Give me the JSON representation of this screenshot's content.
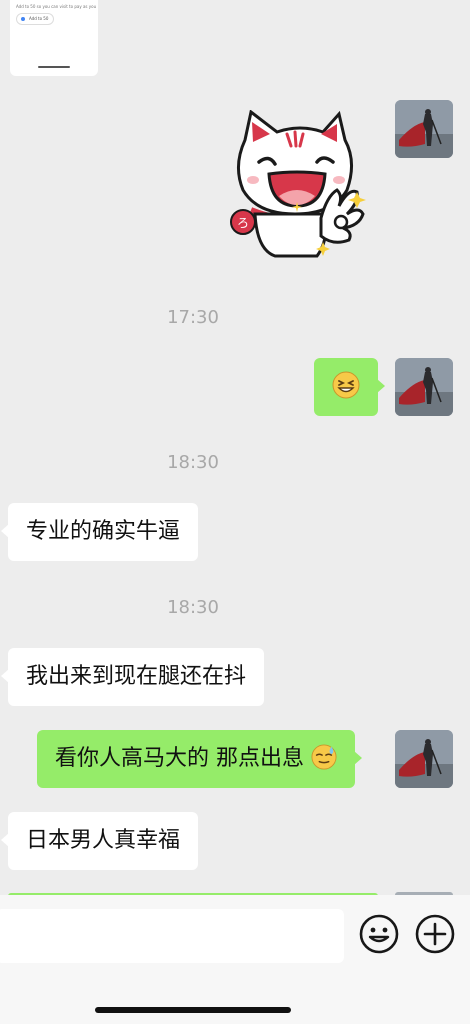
{
  "shared_card": {
    "text": "Add to 50 so you can visit to pay as you bring",
    "chip_label": "Add to 50"
  },
  "messages": [
    {
      "side": "out",
      "type": "sticker",
      "sticker": "cat-ok-sticker"
    },
    {
      "type": "time",
      "text": "17:30"
    },
    {
      "side": "out",
      "type": "emoji",
      "emoji": "grinning-squint-face"
    },
    {
      "type": "time",
      "text": "18:30"
    },
    {
      "side": "in",
      "type": "text",
      "text": "专业的确实牛逼"
    },
    {
      "type": "time",
      "text": "18:30"
    },
    {
      "side": "in",
      "type": "text",
      "text": "我出来到现在腿还在抖"
    },
    {
      "side": "out",
      "type": "text",
      "text": "看你人高马大的 那点出息",
      "emoji": "sweat-smile-face"
    },
    {
      "side": "in",
      "type": "text",
      "text": "日本男人真幸福"
    }
  ],
  "input_bar": {
    "emoji_icon": "emoji-smile-icon",
    "add_icon": "plus-circle-icon"
  },
  "colors": {
    "background": "#ededed",
    "out_bubble": "#95ec69",
    "in_bubble": "#ffffff",
    "timestamp": "#a8a8a8"
  }
}
